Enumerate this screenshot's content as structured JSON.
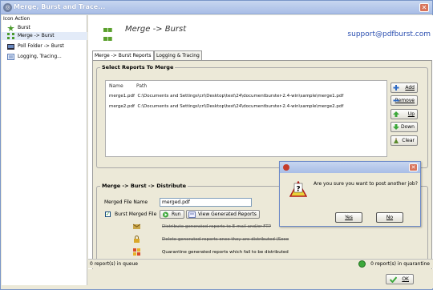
{
  "window": {
    "title": "Merge, Burst and Trace...",
    "close_glyph": "✕"
  },
  "sidebar": {
    "header": "Icon  Action",
    "items": [
      {
        "label": "Burst",
        "icon": "burst-icon"
      },
      {
        "label": "Merge -> Burst",
        "icon": "merge-burst-icon",
        "selected": true
      },
      {
        "label": "Poll Folder -> Burst",
        "icon": "poll-folder-icon"
      },
      {
        "label": "Logging, Tracing...",
        "icon": "logging-icon"
      }
    ]
  },
  "header": {
    "title": "Merge -> Burst",
    "support": "support@pdfburst.com"
  },
  "tabs": [
    {
      "label": "Merge -> Burst Reports",
      "active": true
    },
    {
      "label": "Logging & Tracing",
      "active": false
    }
  ],
  "reports": {
    "group_title": "Select Reports To Merge",
    "columns": [
      "Name",
      "Path"
    ],
    "rows": [
      {
        "name": "merge1.pdf",
        "path": "C:\\Documents and Settings\\cri\\Desktop\\test\\24\\documentburster-2.4-win\\sample\\merge1.pdf"
      },
      {
        "name": "merge2.pdf",
        "path": "C:\\Documents and Settings\\cri\\Desktop\\test\\24\\documentburster-2.4-win\\sample\\merge2.pdf"
      }
    ],
    "buttons": {
      "add": "Add",
      "remove": "Remove",
      "up": "Up",
      "down": "Down",
      "clear": "Clear"
    }
  },
  "distribute": {
    "group_title": "Merge -> Burst -> Distribute",
    "merged_file_label": "Merged File Name",
    "merged_file_value": "merged.pdf",
    "burst_merged_label": "Burst Merged File",
    "burst_checked": true,
    "run_label": "Run",
    "view_label": "View Generated Reports",
    "options": [
      {
        "text": "Distribute generated reports to E-mail and/or FTP",
        "enabled": false
      },
      {
        "text": "Delete generated reports once they are distributed (Seco",
        "enabled": false
      },
      {
        "text": "Quarantine generated reports which fail to be distributed",
        "enabled": true
      }
    ]
  },
  "status": {
    "left": "0 report(s) in queue",
    "right": "0 report(s) in quarantine"
  },
  "ok_label": "OK",
  "dialog": {
    "message": "Are you sure you want to post another job?",
    "yes": "Yes",
    "no": "No",
    "close_glyph": "✕"
  },
  "colors": {
    "titlebar": "#a8bde6",
    "accent": "#2b4fb0",
    "panel": "#ece9d8",
    "status_ok": "#3ca83a"
  }
}
